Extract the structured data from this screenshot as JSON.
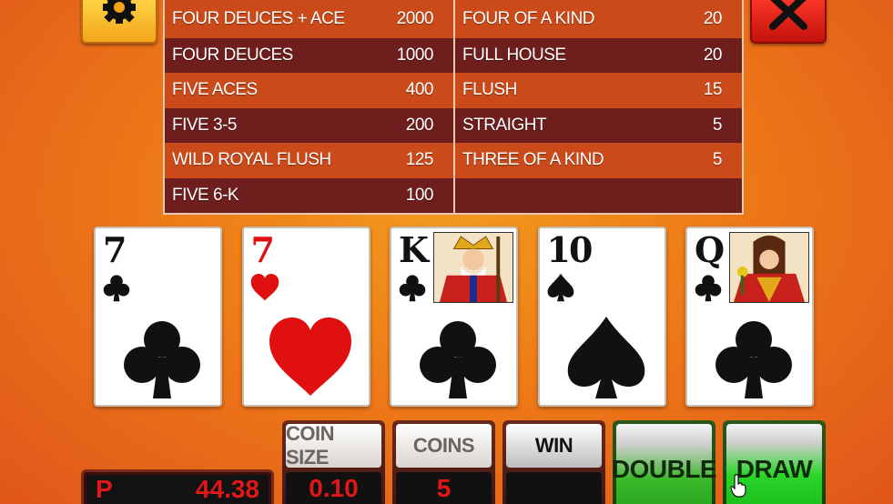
{
  "paytable": {
    "left": [
      {
        "hand": "FOUR DEUCES + ACE",
        "pays": "2000"
      },
      {
        "hand": "FOUR DEUCES",
        "pays": "1000"
      },
      {
        "hand": "FIVE ACES",
        "pays": "400"
      },
      {
        "hand": "FIVE 3-5",
        "pays": "200"
      },
      {
        "hand": "WILD ROYAL FLUSH",
        "pays": "125"
      },
      {
        "hand": "FIVE 6-K",
        "pays": "100"
      }
    ],
    "right": [
      {
        "hand": "FOUR OF A KIND",
        "pays": "20"
      },
      {
        "hand": "FULL HOUSE",
        "pays": "20"
      },
      {
        "hand": "FLUSH",
        "pays": "15"
      },
      {
        "hand": "STRAIGHT",
        "pays": "5"
      },
      {
        "hand": "THREE OF A KIND",
        "pays": "5"
      },
      {
        "hand": "",
        "pays": ""
      }
    ]
  },
  "cards": [
    {
      "rank": "7",
      "suit": "clubs",
      "color": "#111111"
    },
    {
      "rank": "7",
      "suit": "hearts",
      "color": "#e01010"
    },
    {
      "rank": "K",
      "suit": "clubs",
      "color": "#111111",
      "face": "king"
    },
    {
      "rank": "10",
      "suit": "spades",
      "color": "#111111"
    },
    {
      "rank": "Q",
      "suit": "clubs",
      "color": "#111111",
      "face": "queen"
    }
  ],
  "controls": {
    "credits_prefix": "P",
    "credits_value": "44.38",
    "coin_size_label": "COIN SIZE",
    "coin_size_value": "0.10",
    "coins_label": "COINS",
    "coins_value": "5",
    "win_label": "WIN",
    "win_value": "",
    "double_label": "DOUBLE",
    "draw_label": "DRAW"
  },
  "icons": {
    "settings": "gear-icon",
    "close": "close-icon",
    "pointer": "hand-cursor-icon"
  },
  "colors": {
    "background": "#ee7a18",
    "pay_row_light": "#ca4a1a",
    "pay_row_dark": "#6e1e1c",
    "display_red": "#e01818",
    "button_green": "#26a01c"
  }
}
